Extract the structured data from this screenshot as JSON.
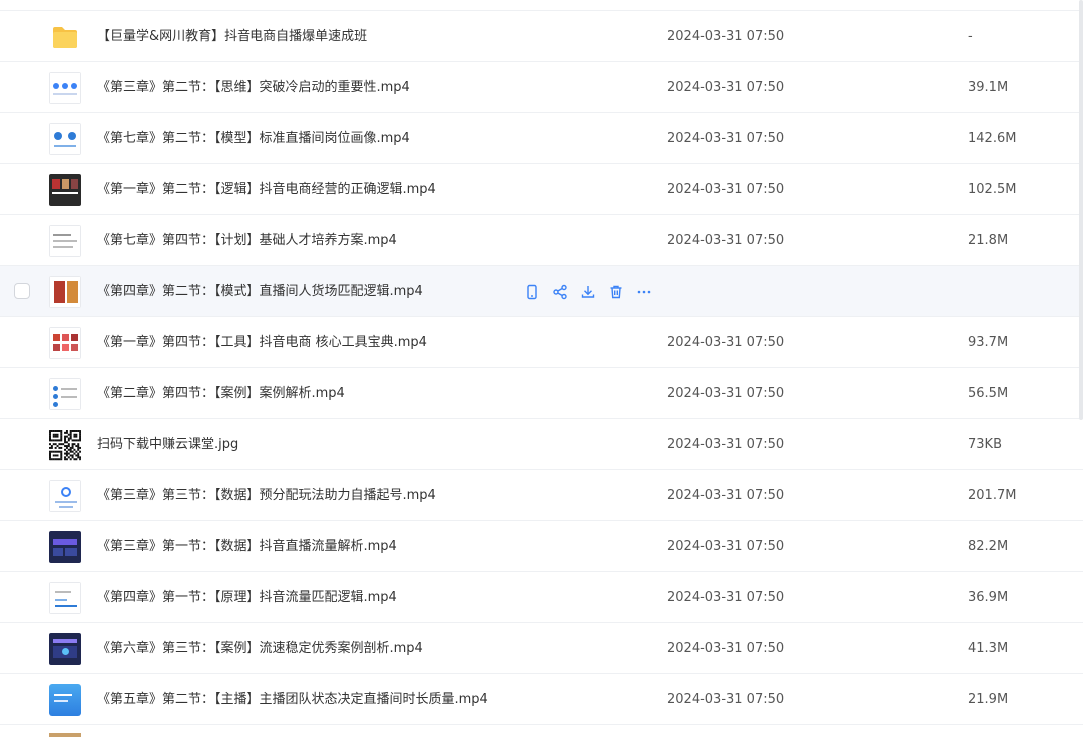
{
  "files": [
    {
      "name": "【巨量学&网川教育】抖音电商自播爆单速成班",
      "date": "2024-03-31 07:50",
      "size": "-",
      "thumb": "folder"
    },
    {
      "name": "《第三章》第二节：【思维】突破冷启动的重要性.mp4",
      "date": "2024-03-31 07:50",
      "size": "39.1M",
      "thumb": "white-blue"
    },
    {
      "name": "《第七章》第二节：【模型】标准直播间岗位画像.mp4",
      "date": "2024-03-31 07:50",
      "size": "142.6M",
      "thumb": "white-circles"
    },
    {
      "name": "《第一章》第二节：【逻辑】抖音电商经营的正确逻辑.mp4",
      "date": "2024-03-31 07:50",
      "size": "102.5M",
      "thumb": "dark-photos"
    },
    {
      "name": "《第七章》第四节：【计划】基础人才培养方案.mp4",
      "date": "2024-03-31 07:50",
      "size": "21.8M",
      "thumb": "white-text"
    },
    {
      "name": "《第四章》第二节：【模式】直播间人货场匹配逻辑.mp4",
      "date": "",
      "size": "",
      "thumb": "red-photos",
      "hover": true
    },
    {
      "name": "《第一章》第四节：【工具】抖音电商 核心工具宝典.mp4",
      "date": "2024-03-31 07:50",
      "size": "93.7M",
      "thumb": "red-grid"
    },
    {
      "name": "《第二章》第四节：【案例】案例解析.mp4",
      "date": "2024-03-31 07:50",
      "size": "56.5M",
      "thumb": "white-list"
    },
    {
      "name": "扫码下载中赚云课堂.jpg",
      "date": "2024-03-31 07:50",
      "size": "73KB",
      "thumb": "qr"
    },
    {
      "name": "《第三章》第三节：【数据】预分配玩法助力自播起号.mp4",
      "date": "2024-03-31 07:50",
      "size": "201.7M",
      "thumb": "white-diagram"
    },
    {
      "name": "《第三章》第一节：【数据】抖音直播流量解析.mp4",
      "date": "2024-03-31 07:50",
      "size": "82.2M",
      "thumb": "navy-dash"
    },
    {
      "name": "《第四章》第一节：【原理】抖音流量匹配逻辑.mp4",
      "date": "2024-03-31 07:50",
      "size": "36.9M",
      "thumb": "white-chart"
    },
    {
      "name": "《第六章》第三节：【案例】流速稳定优秀案例剖析.mp4",
      "date": "2024-03-31 07:50",
      "size": "41.3M",
      "thumb": "navy-dash2"
    },
    {
      "name": "《第五章》第二节：【主播】主播团队状态决定直播间时长质量.mp4",
      "date": "2024-03-31 07:50",
      "size": "21.9M",
      "thumb": "blue"
    }
  ],
  "hover_actions": [
    {
      "name": "phone-icon"
    },
    {
      "name": "share-icon"
    },
    {
      "name": "download-icon"
    },
    {
      "name": "delete-icon"
    },
    {
      "name": "more-icon"
    }
  ],
  "colors": {
    "accent": "#3b82f6",
    "folder": "#f7c245",
    "hover_bg": "#f5f7fb"
  }
}
